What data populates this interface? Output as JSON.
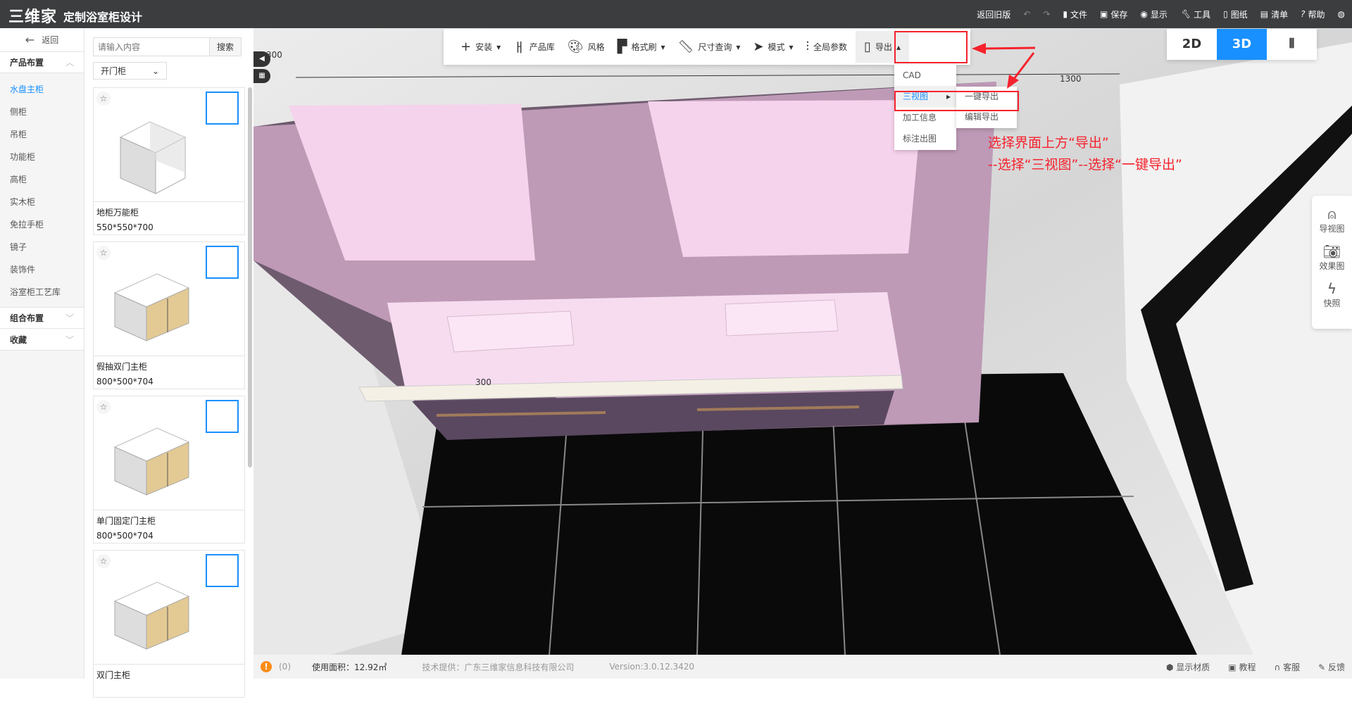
{
  "header": {
    "logo": "三维家",
    "title": "定制浴室柜设计",
    "menu": [
      {
        "icon": "undo-icon",
        "label": ""
      },
      {
        "icon": "redo-icon",
        "label": ""
      },
      {
        "icon": "file-icon",
        "label": "文件"
      },
      {
        "icon": "save-icon",
        "label": "保存"
      },
      {
        "icon": "eye-icon",
        "label": "显示"
      },
      {
        "icon": "wrench-icon",
        "label": "工具"
      },
      {
        "icon": "map-icon",
        "label": "图纸"
      },
      {
        "icon": "list-icon",
        "label": "清单"
      },
      {
        "icon": "help-icon",
        "label": "帮助"
      }
    ],
    "old_version": "返回旧版"
  },
  "nav": {
    "back": "返回",
    "section1": "产品布置",
    "items": [
      "水盘主柜",
      "侧柜",
      "吊柜",
      "功能柜",
      "高柜",
      "实木柜",
      "免拉手柜",
      "镜子",
      "装饰件",
      "浴室柜工艺库"
    ],
    "section2": "组合布置",
    "section3": "收藏"
  },
  "products": {
    "search_placeholder": "请输入内容",
    "search_button": "搜索",
    "filter": "开门柜",
    "cards": [
      {
        "name": "地柜万能柜",
        "size": "550*550*700"
      },
      {
        "name": "假抽双门主柜",
        "size": "800*500*704"
      },
      {
        "name": "单门固定门主柜",
        "size": "800*500*704"
      },
      {
        "name": "双门主柜",
        "size": ""
      }
    ]
  },
  "toolbar": {
    "items": [
      {
        "icon": "plus-icon",
        "label": "安装",
        "dropdown": true
      },
      {
        "icon": "chair-icon",
        "label": "产品库"
      },
      {
        "icon": "palette-icon",
        "label": "风格"
      },
      {
        "icon": "paint-roller-icon",
        "label": "格式刷",
        "dropdown": true
      },
      {
        "icon": "ruler-icon",
        "label": "尺寸查询",
        "dropdown": true
      },
      {
        "icon": "cursor-icon",
        "label": "模式",
        "dropdown": true
      },
      {
        "icon": "sliders-icon",
        "label": "全局参数"
      }
    ],
    "export": "导出"
  },
  "export_menu": {
    "items": [
      "CAD",
      "三视图",
      "加工信息",
      "标注出图"
    ],
    "submenu": [
      "一键导出",
      "编辑导出"
    ]
  },
  "annotation": {
    "line1": "选择界面上方“导出”",
    "line2": "--选择“三视图”--选择“一键导出”"
  },
  "view_toggle": {
    "options": [
      "2D",
      "3D",
      "VR"
    ],
    "active": "3D"
  },
  "scene": {
    "dim_top": "1300",
    "dim_left": "300",
    "dim_corner": "300"
  },
  "right_panel": [
    {
      "icon": "person-icon",
      "label": "导视图"
    },
    {
      "icon": "camera-icon",
      "label": "效果图"
    },
    {
      "icon": "flash-icon",
      "label": "快照"
    }
  ],
  "footer": {
    "count": "(0)",
    "area": "使用面积：12.92㎡",
    "provider": "技术提供：广东三维家信息科技有限公司",
    "version": "Version:3.0.12.3420",
    "links": [
      {
        "icon": "cube-icon",
        "label": "显示材质"
      },
      {
        "icon": "video-icon",
        "label": "教程"
      },
      {
        "icon": "headset-icon",
        "label": "客服"
      },
      {
        "icon": "edit-icon",
        "label": "反馈"
      }
    ]
  },
  "colors": {
    "accent": "#1890ff",
    "highlight": "#f5222d",
    "header": "#3c3d3f"
  }
}
